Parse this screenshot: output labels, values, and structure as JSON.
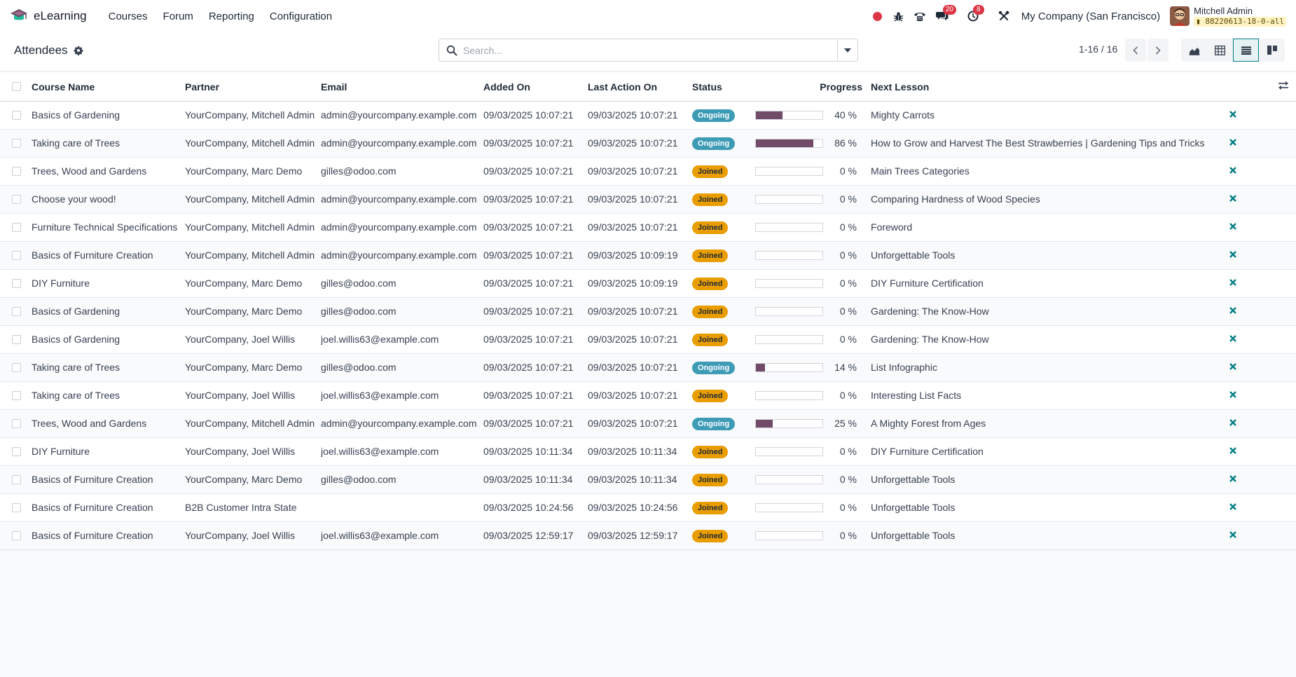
{
  "navbar": {
    "app_name": "eLearning",
    "menu": [
      "Courses",
      "Forum",
      "Reporting",
      "Configuration"
    ],
    "messages_count": "20",
    "activities_count": "8",
    "company": "My Company (San Francisco)",
    "user_name": "Mitchell Admin",
    "db_name": "88220613-18-0-all"
  },
  "control": {
    "title": "Attendees",
    "search_placeholder": "Search...",
    "pager": "1-16 / 16"
  },
  "table": {
    "columns": [
      "Course Name",
      "Partner",
      "Email",
      "Added On",
      "Last Action On",
      "Status",
      "Progress",
      "Next Lesson"
    ],
    "rows": [
      {
        "course": "Basics of Gardening",
        "partner": "YourCompany, Mitchell Admin",
        "email": "admin@yourcompany.example.com",
        "added": "09/03/2025 10:07:21",
        "last": "09/03/2025 10:07:21",
        "status": "Ongoing",
        "progress": 40,
        "progress_label": "40 %",
        "next": "Mighty Carrots"
      },
      {
        "course": "Taking care of Trees",
        "partner": "YourCompany, Mitchell Admin",
        "email": "admin@yourcompany.example.com",
        "added": "09/03/2025 10:07:21",
        "last": "09/03/2025 10:07:21",
        "status": "Ongoing",
        "progress": 86,
        "progress_label": "86 %",
        "next": "How to Grow and Harvest The Best Strawberries | Gardening Tips and Tricks"
      },
      {
        "course": "Trees, Wood and Gardens",
        "partner": "YourCompany, Marc Demo",
        "email": "gilles@odoo.com",
        "added": "09/03/2025 10:07:21",
        "last": "09/03/2025 10:07:21",
        "status": "Joined",
        "progress": 0,
        "progress_label": "0 %",
        "next": "Main Trees Categories"
      },
      {
        "course": "Choose your wood!",
        "partner": "YourCompany, Mitchell Admin",
        "email": "admin@yourcompany.example.com",
        "added": "09/03/2025 10:07:21",
        "last": "09/03/2025 10:07:21",
        "status": "Joined",
        "progress": 0,
        "progress_label": "0 %",
        "next": "Comparing Hardness of Wood Species"
      },
      {
        "course": "Furniture Technical Specifications",
        "partner": "YourCompany, Mitchell Admin",
        "email": "admin@yourcompany.example.com",
        "added": "09/03/2025 10:07:21",
        "last": "09/03/2025 10:07:21",
        "status": "Joined",
        "progress": 0,
        "progress_label": "0 %",
        "next": "Foreword"
      },
      {
        "course": "Basics of Furniture Creation",
        "partner": "YourCompany, Mitchell Admin",
        "email": "admin@yourcompany.example.com",
        "added": "09/03/2025 10:07:21",
        "last": "09/03/2025 10:09:19",
        "status": "Joined",
        "progress": 0,
        "progress_label": "0 %",
        "next": "Unforgettable Tools"
      },
      {
        "course": "DIY Furniture",
        "partner": "YourCompany, Marc Demo",
        "email": "gilles@odoo.com",
        "added": "09/03/2025 10:07:21",
        "last": "09/03/2025 10:09:19",
        "status": "Joined",
        "progress": 0,
        "progress_label": "0 %",
        "next": "DIY Furniture Certification"
      },
      {
        "course": "Basics of Gardening",
        "partner": "YourCompany, Marc Demo",
        "email": "gilles@odoo.com",
        "added": "09/03/2025 10:07:21",
        "last": "09/03/2025 10:07:21",
        "status": "Joined",
        "progress": 0,
        "progress_label": "0 %",
        "next": "Gardening: The Know-How"
      },
      {
        "course": "Basics of Gardening",
        "partner": "YourCompany, Joel Willis",
        "email": "joel.willis63@example.com",
        "added": "09/03/2025 10:07:21",
        "last": "09/03/2025 10:07:21",
        "status": "Joined",
        "progress": 0,
        "progress_label": "0 %",
        "next": "Gardening: The Know-How"
      },
      {
        "course": "Taking care of Trees",
        "partner": "YourCompany, Marc Demo",
        "email": "gilles@odoo.com",
        "added": "09/03/2025 10:07:21",
        "last": "09/03/2025 10:07:21",
        "status": "Ongoing",
        "progress": 14,
        "progress_label": "14 %",
        "next": "List Infographic"
      },
      {
        "course": "Taking care of Trees",
        "partner": "YourCompany, Joel Willis",
        "email": "joel.willis63@example.com",
        "added": "09/03/2025 10:07:21",
        "last": "09/03/2025 10:07:21",
        "status": "Joined",
        "progress": 0,
        "progress_label": "0 %",
        "next": "Interesting List Facts"
      },
      {
        "course": "Trees, Wood and Gardens",
        "partner": "YourCompany, Mitchell Admin",
        "email": "admin@yourcompany.example.com",
        "added": "09/03/2025 10:07:21",
        "last": "09/03/2025 10:07:21",
        "status": "Ongoing",
        "progress": 25,
        "progress_label": "25 %",
        "next": "A Mighty Forest from Ages"
      },
      {
        "course": "DIY Furniture",
        "partner": "YourCompany, Joel Willis",
        "email": "joel.willis63@example.com",
        "added": "09/03/2025 10:11:34",
        "last": "09/03/2025 10:11:34",
        "status": "Joined",
        "progress": 0,
        "progress_label": "0 %",
        "next": "DIY Furniture Certification"
      },
      {
        "course": "Basics of Furniture Creation",
        "partner": "YourCompany, Marc Demo",
        "email": "gilles@odoo.com",
        "added": "09/03/2025 10:11:34",
        "last": "09/03/2025 10:11:34",
        "status": "Joined",
        "progress": 0,
        "progress_label": "0 %",
        "next": "Unforgettable Tools"
      },
      {
        "course": "Basics of Furniture Creation",
        "partner": "B2B Customer Intra State",
        "email": "",
        "added": "09/03/2025 10:24:56",
        "last": "09/03/2025 10:24:56",
        "status": "Joined",
        "progress": 0,
        "progress_label": "0 %",
        "next": "Unforgettable Tools"
      },
      {
        "course": "Basics of Furniture Creation",
        "partner": "YourCompany, Joel Willis",
        "email": "joel.willis63@example.com",
        "added": "09/03/2025 12:59:17",
        "last": "09/03/2025 12:59:17",
        "status": "Joined",
        "progress": 0,
        "progress_label": "0 %",
        "next": "Unforgettable Tools"
      }
    ]
  },
  "colors": {
    "brand": "#714b67",
    "accent": "#017e84",
    "ongoing": "#3d9bb6",
    "joined": "#e99d00",
    "notification": "#dc3545"
  },
  "icons": {
    "row_action": "unlink-icon",
    "optional_columns": "adjust-icon"
  }
}
